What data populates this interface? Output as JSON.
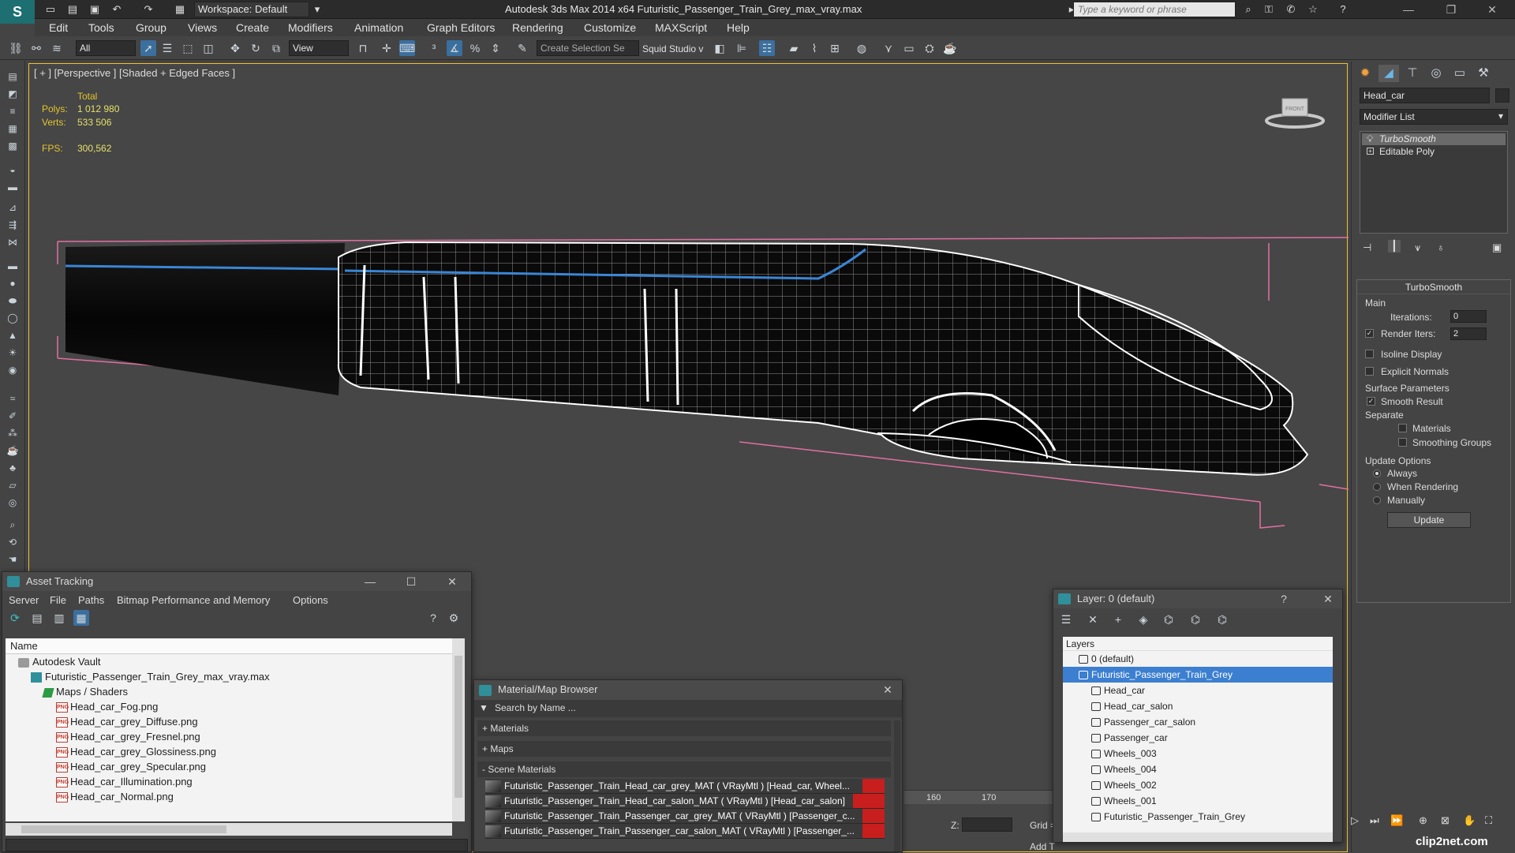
{
  "app": {
    "logo": "S",
    "workspace": "Workspace: Default",
    "title": "Autodesk 3ds Max  2014 x64     Futuristic_Passenger_Train_Grey_max_vray.max",
    "search_placeholder": "Type a keyword or phrase"
  },
  "menu": [
    "Edit",
    "Tools",
    "Group",
    "Views",
    "Create",
    "Modifiers",
    "Animation",
    "Graph Editors",
    "Rendering",
    "Customize",
    "MAXScript",
    "Help"
  ],
  "toolbar": {
    "filter": "All",
    "ref_coord": "View",
    "selection_set": "Create Selection Se",
    "squid": "Squid Studio v"
  },
  "viewport": {
    "label": "[ + ] [Perspective ] [Shaded + Edged Faces ]",
    "total_label": "Total",
    "polys_label": "Polys:",
    "polys": "1 012 980",
    "verts_label": "Verts:",
    "verts": "533 506",
    "fps_label": "FPS:",
    "fps": "300,562",
    "cube_label": "FRONT"
  },
  "command_panel": {
    "object_name": "Head_car",
    "modifier_list": "Modifier List",
    "stack": [
      "TurboSmooth",
      "Editable Poly"
    ],
    "rollout_title": "TurboSmooth",
    "main_label": "Main",
    "iterations_label": "Iterations:",
    "iterations": "0",
    "render_iters_label": "Render Iters:",
    "render_iters": "2",
    "isoline": "Isoline Display",
    "explicit_normals": "Explicit Normals",
    "surface_params": "Surface Parameters",
    "smooth_result": "Smooth Result",
    "separate": "Separate",
    "materials": "Materials",
    "smoothing_groups": "Smoothing Groups",
    "update_options": "Update Options",
    "always": "Always",
    "when_rendering": "When Rendering",
    "manually": "Manually",
    "update_button": "Update"
  },
  "asset_tracking": {
    "title": "Asset Tracking",
    "menu": [
      "Server",
      "File",
      "Paths",
      "Bitmap Performance and Memory",
      "Options"
    ],
    "col_name": "Name",
    "rows": [
      {
        "indent": 1,
        "icon": "vault",
        "text": "Autodesk Vault"
      },
      {
        "indent": 2,
        "icon": "max",
        "text": "Futuristic_Passenger_Train_Grey_max_vray.max"
      },
      {
        "indent": 3,
        "icon": "maps",
        "text": "Maps / Shaders"
      },
      {
        "indent": 4,
        "icon": "png",
        "text": "Head_car_Fog.png"
      },
      {
        "indent": 4,
        "icon": "png",
        "text": "Head_car_grey_Diffuse.png"
      },
      {
        "indent": 4,
        "icon": "png",
        "text": "Head_car_grey_Fresnel.png"
      },
      {
        "indent": 4,
        "icon": "png",
        "text": "Head_car_grey_Glossiness.png"
      },
      {
        "indent": 4,
        "icon": "png",
        "text": "Head_car_grey_Specular.png"
      },
      {
        "indent": 4,
        "icon": "png",
        "text": "Head_car_Illumination.png"
      },
      {
        "indent": 4,
        "icon": "png",
        "text": "Head_car_Normal.png"
      }
    ]
  },
  "material_browser": {
    "title": "Material/Map Browser",
    "search_placeholder": "Search by Name ...",
    "groups": [
      "+ Materials",
      "+ Maps",
      "- Scene Materials"
    ],
    "materials": [
      "Futuristic_Passenger_Train_Head_car_grey_MAT  ( VRayMtl ) [Head_car, Wheel...",
      "Futuristic_Passenger_Train_Head_car_salon_MAT  ( VRayMtl ) [Head_car_salon]",
      "Futuristic_Passenger_Train_Passenger_car_grey_MAT  ( VRayMtl ) [Passenger_c...",
      "Futuristic_Passenger_Train_Passenger_car_salon_MAT  ( VRayMtl ) [Passenger_..."
    ]
  },
  "layer_window": {
    "title": "Layer: 0 (default)",
    "help": "?",
    "header": "Layers",
    "rows": [
      {
        "indent": 0,
        "text": "0 (default)",
        "selected": false
      },
      {
        "indent": 0,
        "text": "Futuristic_Passenger_Train_Grey",
        "selected": true
      },
      {
        "indent": 1,
        "text": "Head_car",
        "selected": false
      },
      {
        "indent": 1,
        "text": "Head_car_salon",
        "selected": false
      },
      {
        "indent": 1,
        "text": "Passenger_car_salon",
        "selected": false
      },
      {
        "indent": 1,
        "text": "Passenger_car",
        "selected": false
      },
      {
        "indent": 1,
        "text": "Wheels_003",
        "selected": false
      },
      {
        "indent": 1,
        "text": "Wheels_004",
        "selected": false
      },
      {
        "indent": 1,
        "text": "Wheels_002",
        "selected": false
      },
      {
        "indent": 1,
        "text": "Wheels_001",
        "selected": false
      },
      {
        "indent": 1,
        "text": "Futuristic_Passenger_Train_Grey",
        "selected": false
      }
    ]
  },
  "timeline": {
    "ticks": [
      "160",
      "170"
    ],
    "z_label": "Z:",
    "grid_label": "Grid =",
    "add_label": "Add T"
  },
  "watermark": "clip2net.com",
  "colors": {
    "accent": "#3b6f9e",
    "viewport_border": "#f2c232",
    "stats": "#e3c52c",
    "selection": "#3c7fd0",
    "material_flag": "#c81e1e"
  }
}
